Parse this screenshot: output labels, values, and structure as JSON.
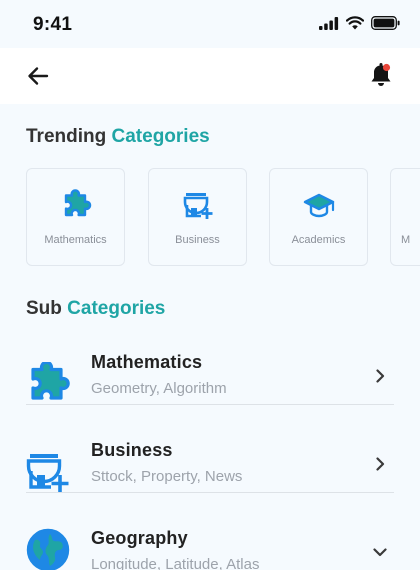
{
  "status": {
    "time": "9:41"
  },
  "trending": {
    "title": "Trending",
    "title_accent": "Categories",
    "items": [
      {
        "label": "Mathematics",
        "icon": "puzzle-icon"
      },
      {
        "label": "Business",
        "icon": "store-add-icon"
      },
      {
        "label": "Academics",
        "icon": "graduation-cap-icon"
      },
      {
        "label": "M",
        "icon": ""
      }
    ]
  },
  "sub": {
    "title": "Sub",
    "title_accent": "Categories",
    "items": [
      {
        "name": "Mathematics",
        "desc": "Geometry, Algorithm",
        "icon": "puzzle-icon",
        "chevron": "chevron-right-icon"
      },
      {
        "name": "Business",
        "desc": "Sttock, Property, News",
        "icon": "store-add-icon",
        "chevron": "chevron-right-icon"
      },
      {
        "name": "Geography",
        "desc": "Longitude, Latitude, Atlas",
        "icon": "globe-icon",
        "chevron": "chevron-down-icon"
      }
    ]
  },
  "colors": {
    "accent": "#1FA5A5",
    "icon_blue": "#1E88E5",
    "notification_dot": "#E8463A",
    "background": "#F5FAFE"
  }
}
